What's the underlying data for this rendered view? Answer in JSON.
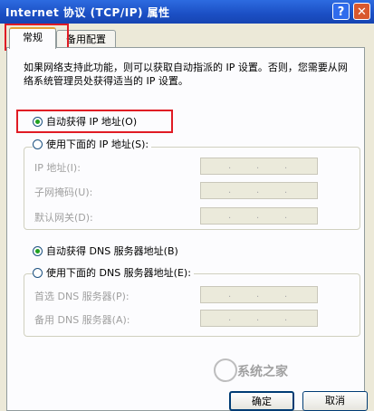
{
  "window": {
    "title": "Internet 协议 (TCP/IP) 属性",
    "help_glyph": "?",
    "close_glyph": "✕"
  },
  "tabs": [
    {
      "label": "常规"
    },
    {
      "label": "备用配置"
    }
  ],
  "description": "如果网络支持此功能，则可以获取自动指派的 IP 设置。否则，您需要从网络系统管理员处获得适当的 IP 设置。",
  "ip": {
    "auto_label": "自动获得 IP 地址(O)",
    "manual_label": "使用下面的 IP 地址(S):",
    "auto_selected": true,
    "fields": [
      {
        "label": "IP 地址(I):"
      },
      {
        "label": "子网掩码(U):"
      },
      {
        "label": "默认网关(D):"
      }
    ]
  },
  "dns": {
    "auto_label": "自动获得 DNS 服务器地址(B)",
    "manual_label": "使用下面的 DNS 服务器地址(E):",
    "auto_selected": true,
    "fields": [
      {
        "label": "首选 DNS 服务器(P):"
      },
      {
        "label": "备用 DNS 服务器(A):"
      }
    ]
  },
  "ip_dot": ".",
  "buttons": {
    "ok": "确定",
    "cancel": "取消"
  },
  "watermark": "系统之家",
  "colors": {
    "title_bar": "#1b4fc4",
    "highlight": "#e01b24",
    "radio_dot": "#21a121"
  }
}
